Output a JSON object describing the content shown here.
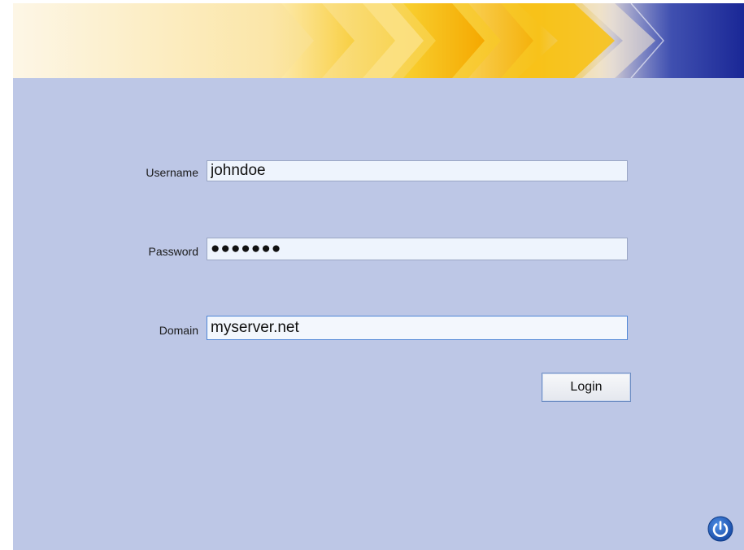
{
  "form": {
    "username_label": "Username",
    "username_value": "johndoe",
    "password_label": "Password",
    "password_display": "●●●●●●●",
    "domain_label": "Domain",
    "domain_value": "myserver.net"
  },
  "buttons": {
    "login_label": "Login",
    "power_icon": "power-icon"
  },
  "colors": {
    "background": "#bdc7e6",
    "input_background": "#eef4fd",
    "focus_border": "#4f86d6",
    "power_button": "#1f5cb5",
    "banner_yellow": "#f7c21a",
    "banner_orange": "#f5a300",
    "banner_navy": "#1e2d9a"
  }
}
